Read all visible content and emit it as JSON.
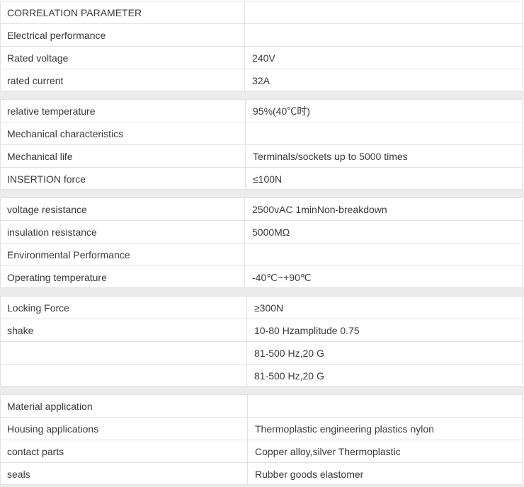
{
  "blocks": [
    {
      "rows": [
        {
          "param": "CORRELATION PARAMETER",
          "value": ""
        },
        {
          "param": "Electrical performance",
          "value": ""
        },
        {
          "param": "Rated voltage",
          "value": "240V"
        },
        {
          "param": "rated current",
          "value": "32A"
        }
      ]
    },
    {
      "rows": [
        {
          "param": "relative temperature",
          "value": "95%(40℃时)"
        },
        {
          "param": "Mechanical characteristics",
          "value": ""
        },
        {
          "param": "Mechanical life",
          "value": "Terminals/sockets up to 5000 times"
        },
        {
          "param": "INSERTION force",
          "value": "≤100N"
        }
      ]
    },
    {
      "rows": [
        {
          "param": "voltage resistance",
          "value": "2500vAC 1minNon-breakdown"
        },
        {
          "param": "insulation resistance",
          "value": "5000MΩ"
        },
        {
          "param": "Environmental Performance",
          "value": ""
        },
        {
          "param": "Operating temperature",
          "value": "-40℃~+90℃"
        }
      ]
    },
    {
      "rows": [
        {
          "param": "Locking Force",
          "value": "≥300N"
        },
        {
          "param": "shake",
          "value": "10-80 Hzamplitude 0.75"
        },
        {
          "param": "",
          "value": "81-500 Hz,20 G"
        },
        {
          "param": "",
          "value": "81-500 Hz,20 G"
        }
      ]
    },
    {
      "rows": [
        {
          "param": "Material application",
          "value": ""
        },
        {
          "param": "Housing applications",
          "value": "Thermoplastic engineering plastics nylon"
        },
        {
          "param": "contact parts",
          "value": "Copper alloy,silver Thermoplastic"
        },
        {
          "param": "seals",
          "value": "Rubber goods elastomer"
        }
      ]
    }
  ]
}
